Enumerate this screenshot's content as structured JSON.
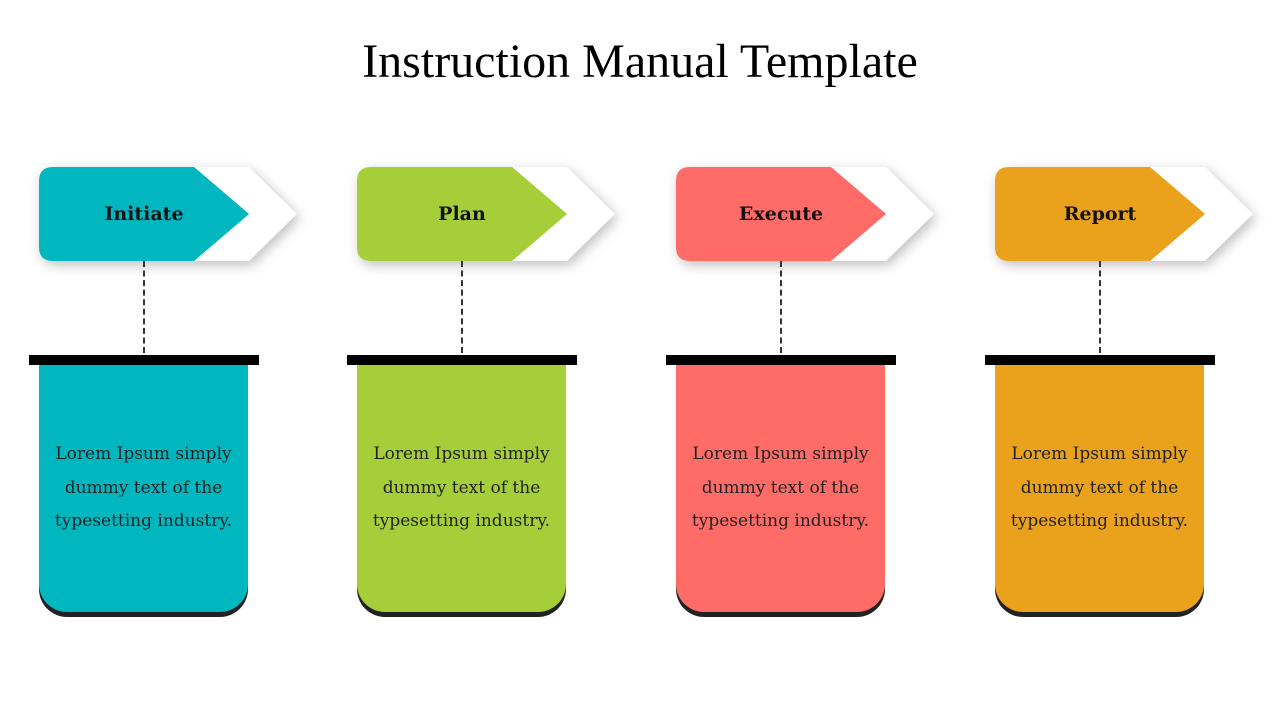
{
  "title": "Instruction Manual Template",
  "steps": [
    {
      "label": "Initiate",
      "color": "#00B7C0",
      "text": "Lorem Ipsum simply dummy text of the typesetting industry."
    },
    {
      "label": "Plan",
      "color": "#A6CE39",
      "text": "Lorem Ipsum simply dummy text of the typesetting industry."
    },
    {
      "label": "Execute",
      "color": "#FF6B67",
      "text": "Lorem Ipsum simply dummy text of the typesetting industry."
    },
    {
      "label": "Report",
      "color": "#EAA21D",
      "text": "Lorem Ipsum simply dummy text of the typesetting industry."
    }
  ]
}
